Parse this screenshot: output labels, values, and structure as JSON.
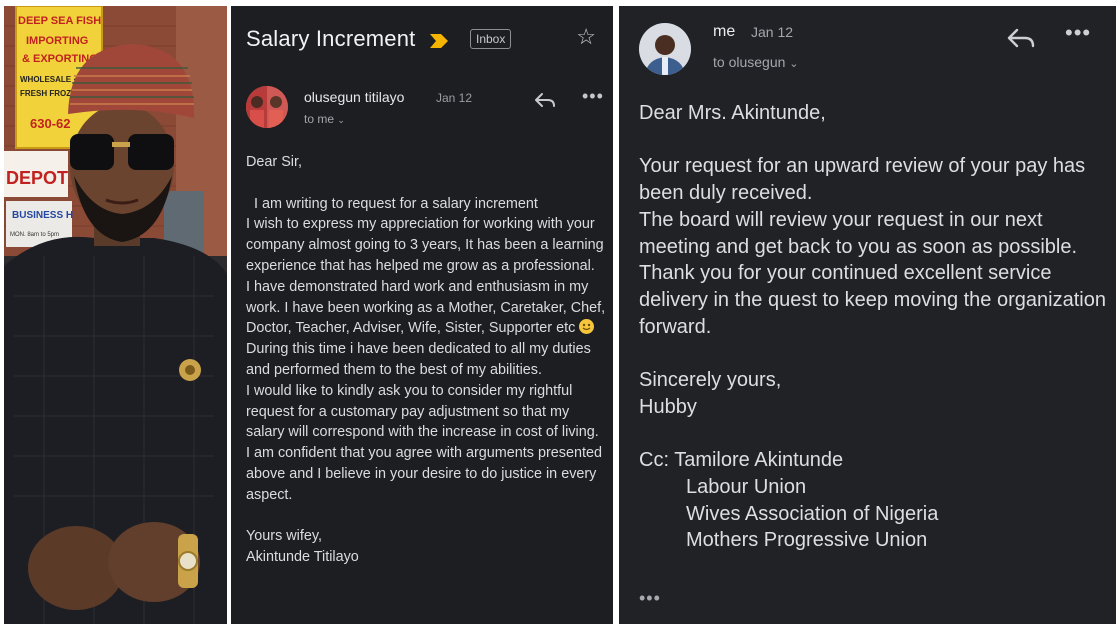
{
  "photo_panel": {
    "signs": {
      "top_sign": [
        "DEEP SEA FISH",
        "IMPORTING",
        "& EXPORTING",
        "WHOLESALE · R",
        "FRESH FROZEN",
        "630-62"
      ],
      "depot_sign": "DEPOT FR",
      "business_sign": "BUSINESS H",
      "hours_text": "MON. 8am to 5pm"
    }
  },
  "email1": {
    "subject": "Salary Increment",
    "label": "Inbox",
    "sender": "olusegun titilayo",
    "date": "Jan 12",
    "to": "to me",
    "greeting": "Dear Sir,",
    "paragraph1": "I am writing to request for a salary increment",
    "paragraph2": "I wish to express my appreciation for working with your company almost going to 3 years, It has been a learning experience that has helped me grow as a professional.",
    "paragraph3_a": "I have demonstrated hard work and enthusiasm in my work. I have been working as a Mother, Caretaker, Chef, Doctor, Teacher, Adviser, Wife, Sister, Supporter etc",
    "paragraph3_b": "During this time i have been dedicated to all my duties and performed them to the best of my abilities.",
    "paragraph4": "I would like to kindly ask you to consider my rightful request for a customary pay adjustment so that my salary will correspond with the increase in cost of living. I am confident that you agree with arguments presented above and I believe in your desire to do justice in every aspect.",
    "signoff": "Yours wifey,",
    "signature": "Akintunde Titilayo"
  },
  "email2": {
    "sender": "me",
    "date": "Jan 12",
    "to": "to olusegun",
    "greeting": "Dear Mrs. Akintunde,",
    "lines": [
      "Your request for an upward review of your pay has been duly received.",
      "The board will review your request in our next meeting and get back to you as soon as possible.",
      "Thank you for your continued excellent service delivery in the quest to keep moving the organization forward."
    ],
    "signoff": "Sincerely yours,",
    "signature": "Hubby",
    "cc_label": "Cc: Tamilore Akintunde",
    "cc_list": [
      "Labour Union",
      "Wives Association of Nigeria",
      "Mothers Progressive Union"
    ],
    "trimmed": "•••"
  },
  "icons": {
    "star": "star-icon",
    "reply": "reply-icon",
    "more": "more-vert-icon",
    "importance": "importance-marker-icon",
    "chevron": "chevron-down-icon"
  },
  "colors": {
    "email1_bg": "#1d1e22",
    "email2_bg": "#202226",
    "importance_yellow": "#f4b400"
  }
}
